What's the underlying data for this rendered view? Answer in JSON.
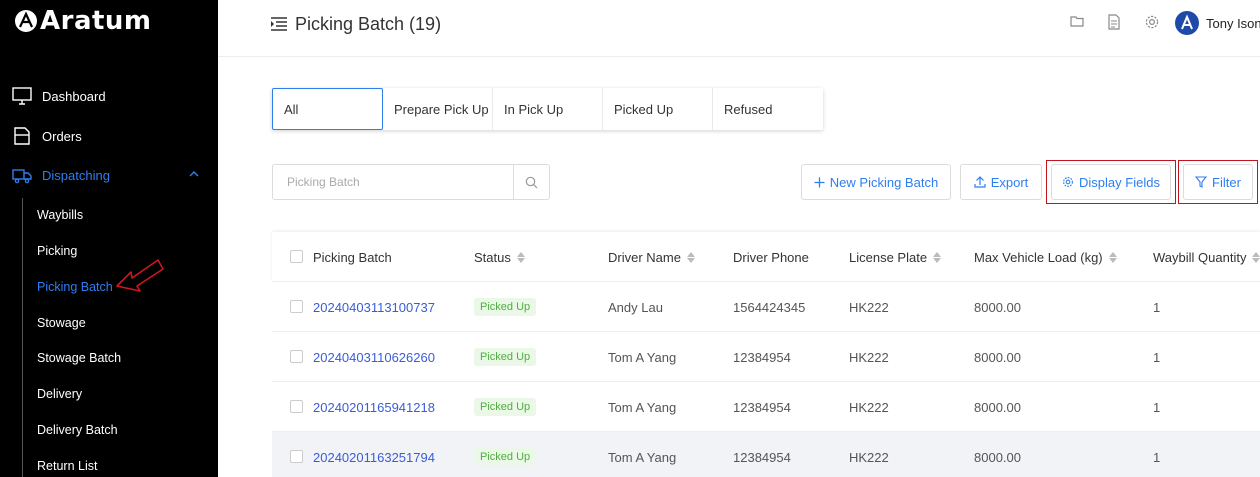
{
  "app": {
    "logo_text": "Aratum"
  },
  "sidebar": {
    "items": [
      {
        "label": "Dashboard",
        "icon": "monitor-icon"
      },
      {
        "label": "Orders",
        "icon": "orders-icon"
      },
      {
        "label": "Dispatching",
        "icon": "truck-icon"
      }
    ],
    "submenu": [
      "Waybills",
      "Picking",
      "Picking Batch",
      "Stowage",
      "Stowage Batch",
      "Delivery",
      "Delivery Batch",
      "Return List"
    ],
    "active_submenu": "Picking Batch"
  },
  "header": {
    "title": "Picking Batch (19)",
    "user_name": "Tony Ison",
    "icons": [
      "folder-icon",
      "document-icon",
      "gear-icon"
    ]
  },
  "tabs": [
    "All",
    "Prepare Pick Up",
    "In Pick Up",
    "Picked Up",
    "Refused"
  ],
  "active_tab": "All",
  "search": {
    "placeholder": "Picking Batch",
    "value": ""
  },
  "toolbar": {
    "new_label": "New Picking Batch",
    "export_label": "Export",
    "display_fields_label": "Display Fields",
    "filter_label": "Filter"
  },
  "table": {
    "columns": [
      "Picking Batch",
      "Status",
      "Driver Name",
      "Driver Phone",
      "License Plate",
      "Max Vehicle Load (kg)",
      "Waybill Quantity"
    ],
    "rows": [
      {
        "batch": "20240403113100737",
        "status": "Picked Up",
        "driver": "Andy Lau",
        "phone": "1564424345",
        "plate": "HK222",
        "load": "8000.00",
        "qty": "1"
      },
      {
        "batch": "20240403110626260",
        "status": "Picked Up",
        "driver": "Tom A Yang",
        "phone": "12384954",
        "plate": "HK222",
        "load": "8000.00",
        "qty": "1"
      },
      {
        "batch": "20240201165941218",
        "status": "Picked Up",
        "driver": "Tom A Yang",
        "phone": "12384954",
        "plate": "HK222",
        "load": "8000.00",
        "qty": "1"
      },
      {
        "batch": "20240201163251794",
        "status": "Picked Up",
        "driver": "Tom A Yang",
        "phone": "12384954",
        "plate": "HK222",
        "load": "8000.00",
        "qty": "1"
      }
    ]
  },
  "colors": {
    "accent": "#2f7ef0",
    "link": "#3a5dd6",
    "status_green": "#4caf3f",
    "highlight_red": "#c0141e"
  }
}
